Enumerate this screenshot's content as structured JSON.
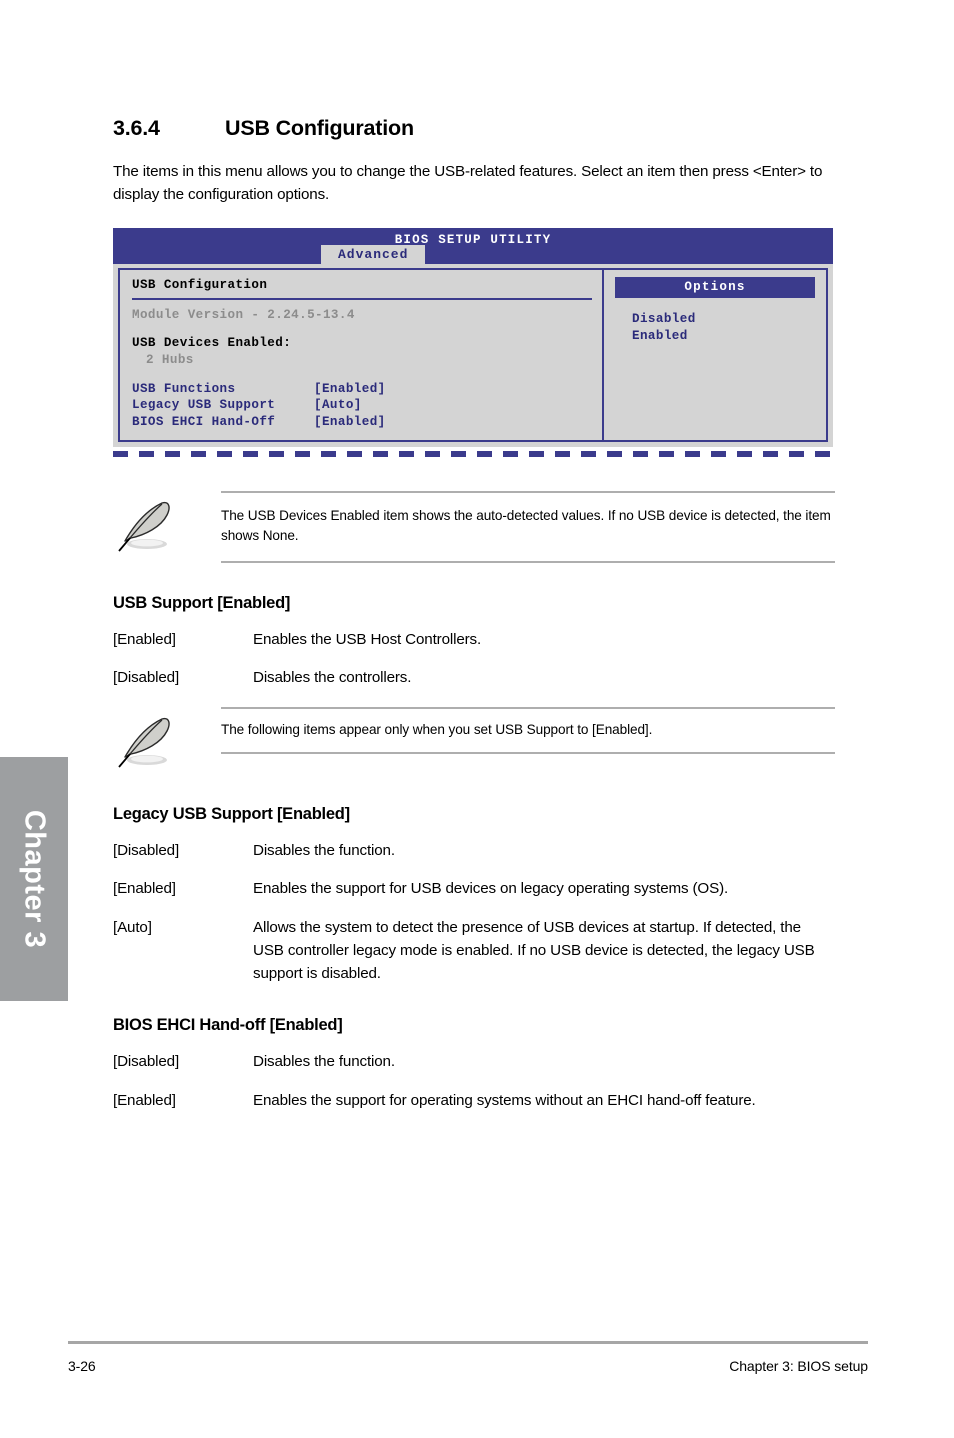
{
  "chapter_tab": {
    "label": "Chapter 3"
  },
  "section": {
    "number": "3.6.4",
    "title": "USB Configuration",
    "intro": "The items in this menu allows you to change the USB-related features. Select an item then press <Enter> to display the configuration options."
  },
  "bios": {
    "title": "BIOS SETUP UTILITY",
    "tab": "Advanced",
    "left_panel": {
      "heading": "USB Configuration",
      "module_version": "Module Version - 2.24.5-13.4",
      "devices_label": "USB Devices Enabled:",
      "devices_value": "2 Hubs",
      "items": [
        {
          "name": "USB Functions",
          "value": "[Enabled]"
        },
        {
          "name": "Legacy USB Support",
          "value": "[Auto]"
        },
        {
          "name": "BIOS EHCI Hand-Off",
          "value": "[Enabled]"
        }
      ]
    },
    "options_panel": {
      "heading": "Options",
      "choices": [
        "Disabled",
        "Enabled"
      ]
    },
    "colors": {
      "navy": "#3b3b8c",
      "panel_gray": "#d4d4d4",
      "dim_text": "#8c8c8c",
      "blue_text": "#2a2a7a"
    }
  },
  "notes": [
    {
      "text": "The USB Devices Enabled item shows the auto-detected values. If no USB device is detected, the item shows None."
    },
    {
      "text": "The following items appear only when you set USB Support to [Enabled]."
    }
  ],
  "options": [
    {
      "title": "USB Support [Enabled]",
      "rows": [
        {
          "term": "[Enabled]",
          "desc": "Enables the USB Host Controllers."
        },
        {
          "term": "[Disabled]",
          "desc": "Disables the controllers."
        }
      ]
    },
    {
      "title": "Legacy USB Support [Enabled]",
      "rows": [
        {
          "term": "[Disabled]",
          "desc": "Disables the function."
        },
        {
          "term": "[Enabled]",
          "desc": "Enables the support for USB devices on legacy operating systems (OS)."
        },
        {
          "term": "[Auto]",
          "desc": "Allows the system to detect the presence of USB devices at startup. If detected, the USB controller legacy mode is enabled. If no USB device is detected, the legacy USB support is disabled."
        }
      ]
    },
    {
      "title": "BIOS EHCI Hand-off [Enabled]",
      "rows": [
        {
          "term": "[Disabled]",
          "desc": "Disables the function."
        },
        {
          "term": "[Enabled]",
          "desc": "Enables the support for operating systems without an EHCI hand-off feature."
        }
      ]
    }
  ],
  "footer": {
    "page_number": "3-26",
    "chapter_label": "Chapter 3: BIOS setup"
  }
}
